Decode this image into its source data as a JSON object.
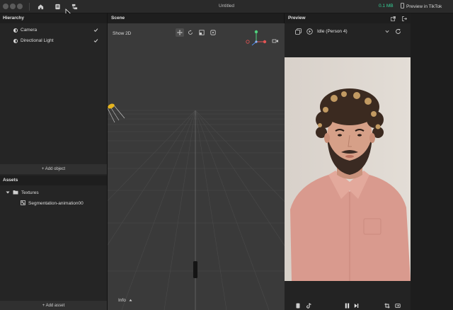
{
  "window": {
    "title": "Untitled",
    "memory": "0.1 MB",
    "preview_label": "Preview in TikTok"
  },
  "hierarchy": {
    "header": "Hierarchy",
    "items": [
      {
        "label": "Camera",
        "checked": true
      },
      {
        "label": "Directional Light",
        "checked": true
      }
    ],
    "add_label": "+ Add object"
  },
  "assets": {
    "header": "Assets",
    "folder": "Textures",
    "file": "Segmentation-animation00",
    "add_label": "+ Add asset"
  },
  "scene": {
    "header": "Scene",
    "show_2d": "Show 2D",
    "info": "Info",
    "axis_colors": {
      "x": "#e05454",
      "y": "#4fd17c",
      "z": "#4f8ef0"
    }
  },
  "preview": {
    "header": "Preview",
    "mode": "Idle (Person 4)"
  },
  "colors": {
    "accent_green": "#37d399",
    "shirt": "#d99a8e",
    "background_photo": "#ddd6cf"
  }
}
